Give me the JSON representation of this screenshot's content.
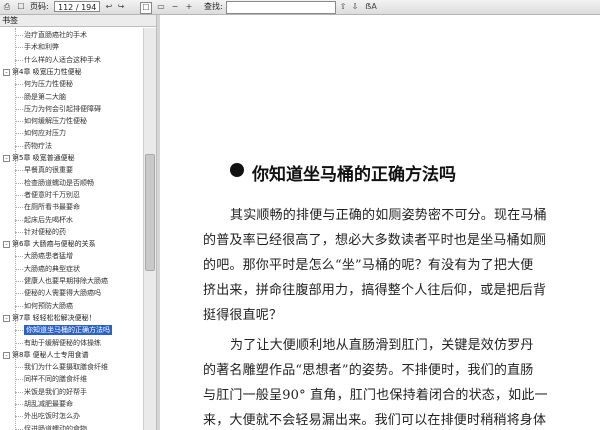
{
  "toolbar": {
    "pages_label": "页码:",
    "current_page": "112",
    "total_pages": "/ 194",
    "search_label": "查找:",
    "search_value": "",
    "prev_icon": "◀",
    "next_icon": "▶",
    "back_icon": "↩",
    "forward_icon": "↪",
    "page_view_icon": "☐",
    "fit_icon": "▭",
    "zoom_out_icon": "−",
    "zoom_in_icon": "+",
    "print_icon": "⎙",
    "search_prev_icon": "⇧",
    "search_next_icon": "⇩",
    "case_icon": "ẞA"
  },
  "sidebar": {
    "header": "书签",
    "items": [
      {
        "label": "治疗直肠癌社的手术",
        "level": 2
      },
      {
        "label": "手术和利弊",
        "level": 2
      },
      {
        "label": "什么样的人适合这种手术",
        "level": 2
      },
      {
        "label": "第4章 吸宽压力性便秘",
        "level": 1
      },
      {
        "label": "何为压力性便秘",
        "level": 2
      },
      {
        "label": "肠是第二大脑",
        "level": 2
      },
      {
        "label": "压力为何会引起排便障碍",
        "level": 2
      },
      {
        "label": "如何缓解压力性便秘",
        "level": 2
      },
      {
        "label": "如何应对压力",
        "level": 2
      },
      {
        "label": "药物疗法",
        "level": 2
      },
      {
        "label": "第5章 吸宽普通便秘",
        "level": 1
      },
      {
        "label": "早餐真的很重要",
        "level": 2
      },
      {
        "label": "检查肠道蠕动是否顺畅",
        "level": 2
      },
      {
        "label": "者便意时千万别忍",
        "level": 2
      },
      {
        "label": "在厕所看书最要命",
        "level": 2
      },
      {
        "label": "起床后先喝杯水",
        "level": 2
      },
      {
        "label": "针对便秘的药",
        "level": 2
      },
      {
        "label": "第6章 大肠癌与便秘的关系",
        "level": 1
      },
      {
        "label": "大肠癌患者猛增",
        "level": 2
      },
      {
        "label": "大肠癌的典型症状",
        "level": 2
      },
      {
        "label": "健康人也要早期排除大肠癌",
        "level": 2
      },
      {
        "label": "便秘的人需要得大肠癌吗",
        "level": 2
      },
      {
        "label": "如何预防大肠癌",
        "level": 2
      },
      {
        "label": "第7章 轻轻松松解决便秘！",
        "level": 1
      },
      {
        "label": "你知道坐马桶的正确方法吗",
        "level": 2,
        "selected": true
      },
      {
        "label": "有助于缓解便秘的体操练",
        "level": 2
      },
      {
        "label": "第8章 便秘人士专用食谱",
        "level": 1
      },
      {
        "label": "我们为什么要摄取膳食纤维",
        "level": 2
      },
      {
        "label": "同样不同的膳食纤维",
        "level": 2
      },
      {
        "label": "米饭是我们的好帮手",
        "level": 2
      },
      {
        "label": "胡乱减肥最要命",
        "level": 2
      },
      {
        "label": "外出吃饭时怎么办",
        "level": 2
      },
      {
        "label": "促进肠道蠕动的食物",
        "level": 2
      }
    ]
  },
  "document": {
    "title": "你知道坐马桶的正确方法吗",
    "lines": [
      "其实顺畅的排便与正确的如厕姿势密不可分。现在马桶",
      "的普及率已经很高了，想必大多数读者平时也是坐马桶如厕",
      "的吧。那你平时是怎么“坐”马桶的呢？有没有为了把大便",
      "挤出来，拼命往腹部用力，搞得整个人往后仰，或是把后背",
      "挺得很直呢？",
      "为了让大便顺利地从直肠滑到肛门，关键是效仿罗丹",
      "的著名雕塑作品“思想者”的姿势。不排便时，我们的直肠",
      "与肛门一般呈90° 直角，肛门也保持着闭合的状态，如此一",
      "来，大便就不会轻易漏出来。我们可以在排便时稍稍将身体"
    ]
  }
}
